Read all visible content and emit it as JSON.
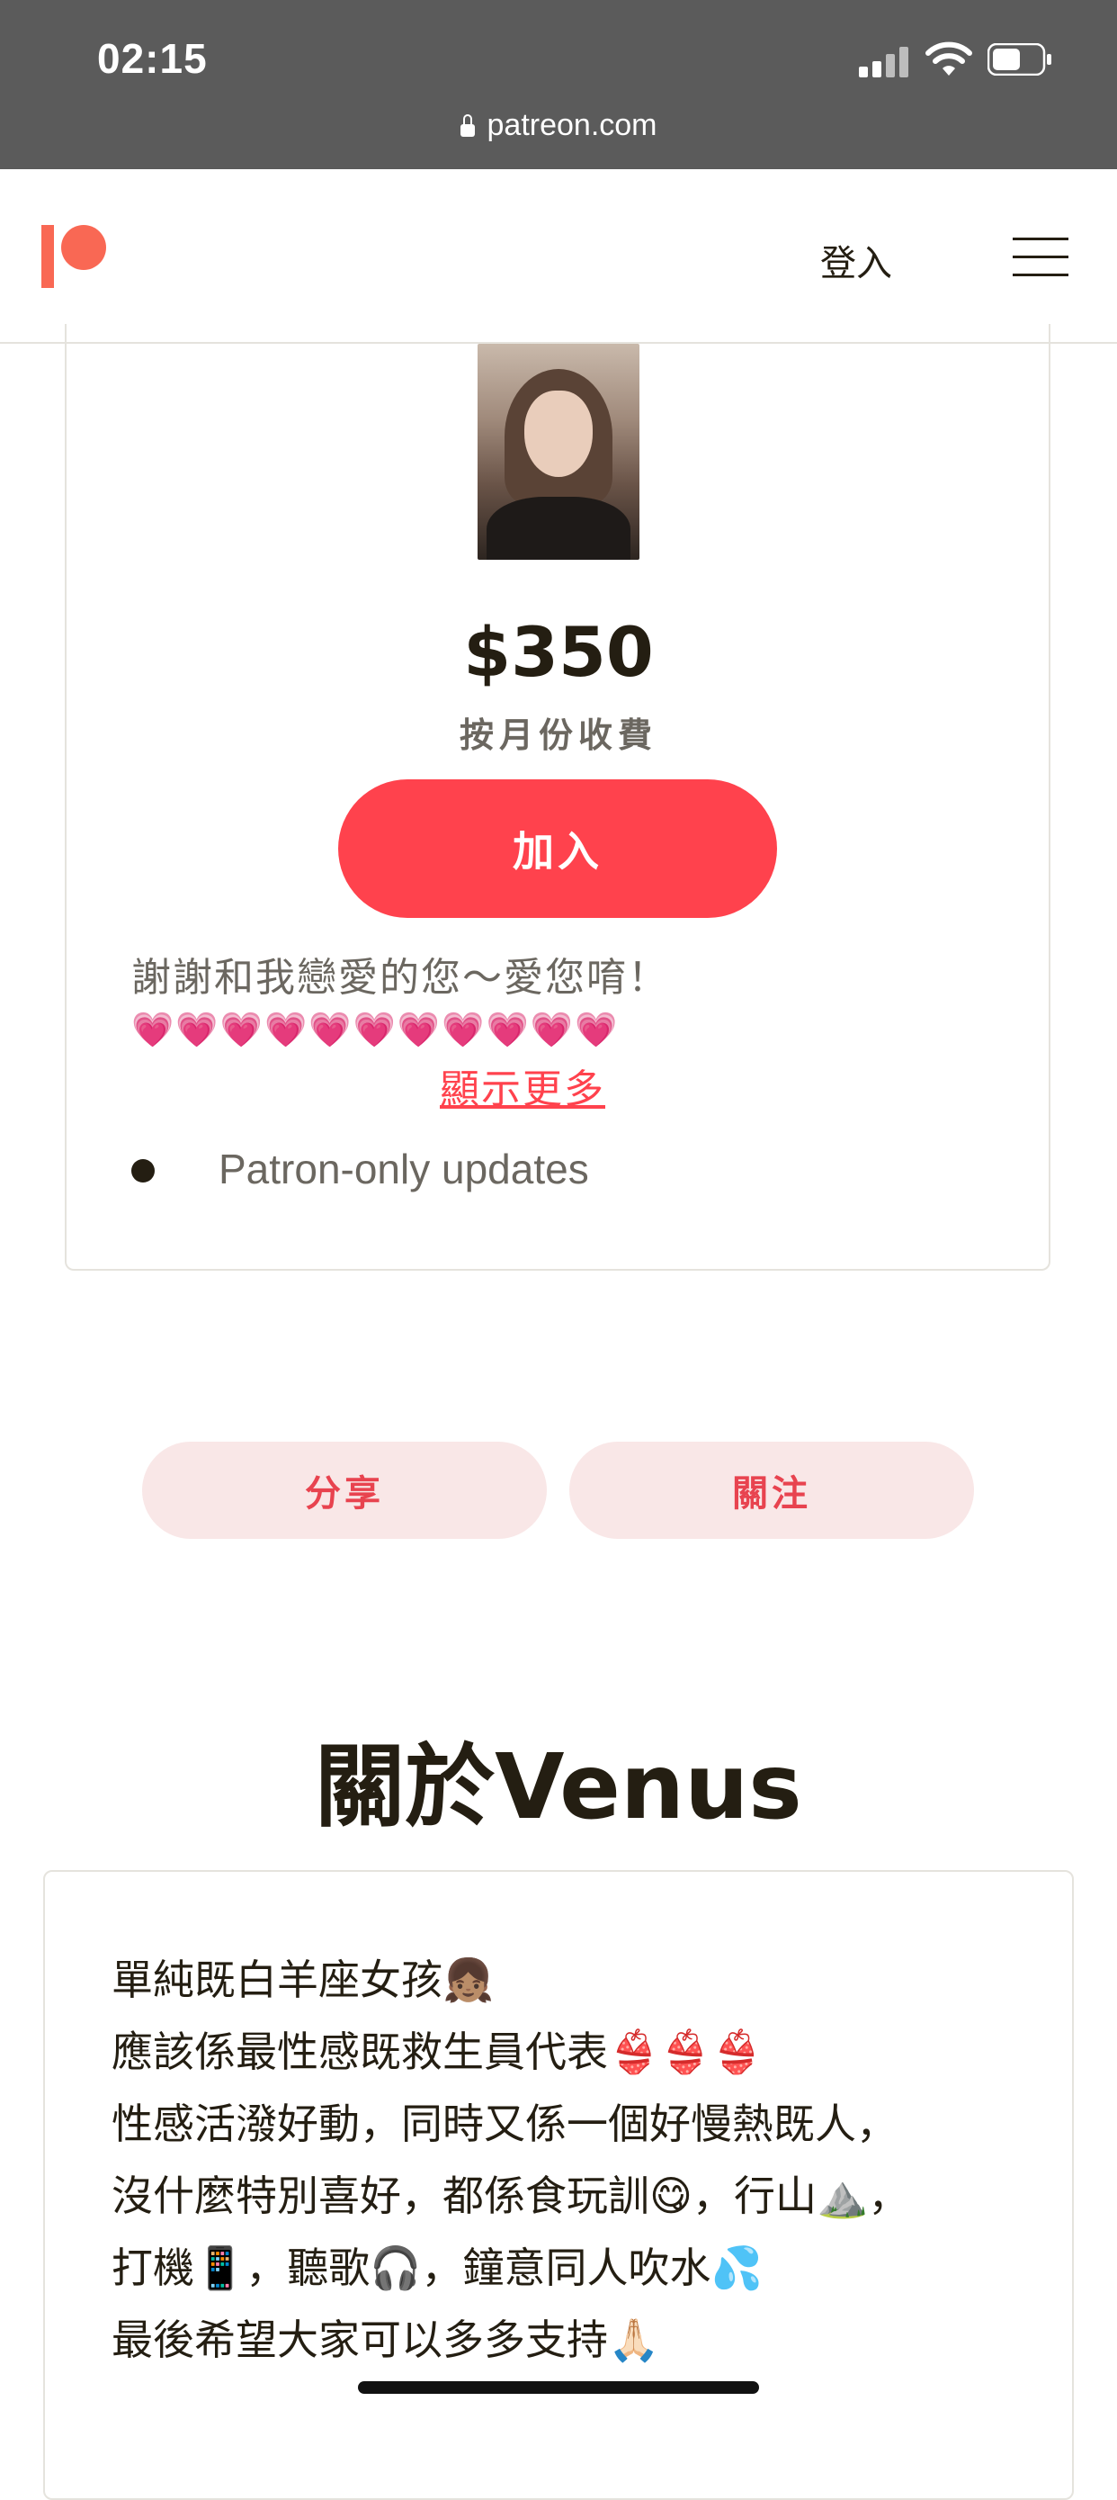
{
  "status_bar": {
    "time": "02:15",
    "url": "patreon.com"
  },
  "header": {
    "login_label": "登入"
  },
  "tier": {
    "price": "$350",
    "billing": "按月份收費",
    "join_label": "加入",
    "description": "謝謝和我戀愛的您～愛您唷！",
    "hearts": "💗💗💗💗💗💗💗💗💗💗💗",
    "show_more": "顯示更多",
    "benefits": [
      "Patron-only updates"
    ]
  },
  "actions": {
    "share_label": "分享",
    "follow_label": "關注"
  },
  "about": {
    "title": "關於Venus",
    "lines": [
      "單純既白羊座女孩👧🏽",
      "應該係最性感既救生員代表👙👙👙",
      "性感活潑好動，同時又係一個好慢熱既人，",
      "沒什麼特別喜好，都係食玩訓😋，行山⛰️，",
      "打機📱，聽歌🎧，鐘意同人吹水💦",
      "最後希望大家可以多多支持🙏🏻"
    ]
  }
}
